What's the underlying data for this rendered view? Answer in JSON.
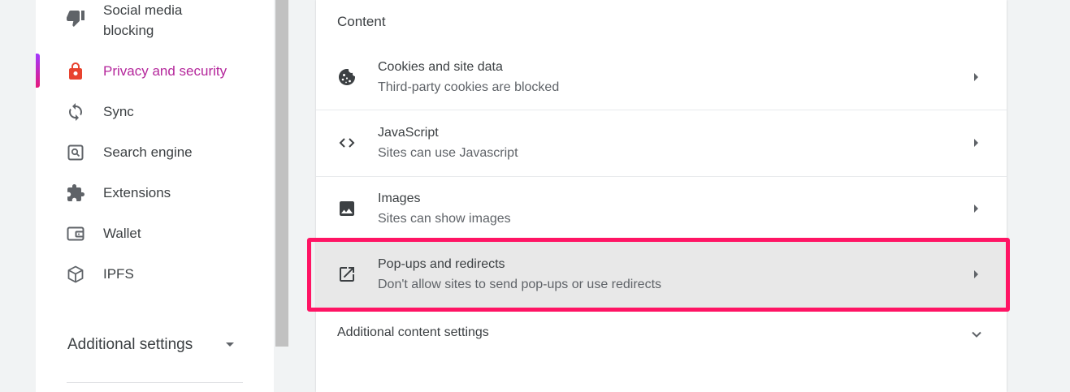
{
  "sidebar": {
    "items": [
      {
        "label": "Social media blocking",
        "icon": "thumb-down-icon"
      },
      {
        "label": "Privacy and security",
        "icon": "lock-icon",
        "active": true
      },
      {
        "label": "Sync",
        "icon": "sync-icon"
      },
      {
        "label": "Search engine",
        "icon": "search-engine-icon"
      },
      {
        "label": "Extensions",
        "icon": "puzzle-icon"
      },
      {
        "label": "Wallet",
        "icon": "wallet-icon"
      },
      {
        "label": "IPFS",
        "icon": "cube-icon"
      }
    ],
    "additional_settings": "Additional settings"
  },
  "content": {
    "section_title": "Content",
    "rows": [
      {
        "title": "Cookies and site data",
        "subtitle": "Third-party cookies are blocked",
        "icon": "cookie-icon"
      },
      {
        "title": "JavaScript",
        "subtitle": "Sites can use Javascript",
        "icon": "code-icon"
      },
      {
        "title": "Images",
        "subtitle": "Sites can show images",
        "icon": "image-icon"
      },
      {
        "title": "Pop-ups and redirects",
        "subtitle": "Don't allow sites to send pop-ups or use redirects",
        "icon": "open-in-new-icon",
        "highlighted": true
      }
    ],
    "additional_content_settings": "Additional content settings"
  },
  "colors": {
    "active_text": "#b4269b",
    "highlight_border": "#ff1464",
    "active_icon": "#e8432f"
  }
}
